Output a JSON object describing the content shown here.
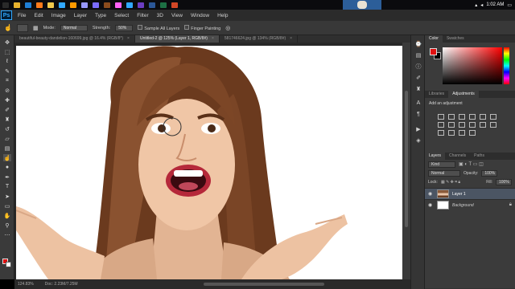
{
  "taskbar": {
    "apps": [
      {
        "name": "start",
        "color": "#2a2a2a"
      },
      {
        "name": "chrome",
        "color": "#e8b22e"
      },
      {
        "name": "edge",
        "color": "#1f7fd6"
      },
      {
        "name": "firefox",
        "color": "#ff7a1a"
      },
      {
        "name": "explorer",
        "color": "#f2c94c"
      },
      {
        "name": "photoshop",
        "color": "#31a8ff"
      },
      {
        "name": "illustrator",
        "color": "#ff9a00"
      },
      {
        "name": "premiere",
        "color": "#9999ff"
      },
      {
        "name": "after-effects",
        "color": "#7b6cff"
      },
      {
        "name": "bridge",
        "color": "#8a4b1d"
      },
      {
        "name": "adobe-xd",
        "color": "#ff61f6"
      },
      {
        "name": "lightroom",
        "color": "#31a8ff"
      },
      {
        "name": "media-encoder",
        "color": "#6b3ec2"
      },
      {
        "name": "word",
        "color": "#2b5797"
      },
      {
        "name": "excel",
        "color": "#1d7044"
      },
      {
        "name": "powerpoint",
        "color": "#d24726"
      }
    ],
    "clock": "1:02 AM"
  },
  "app": {
    "logo": "Ps"
  },
  "menu": [
    "File",
    "Edit",
    "Image",
    "Layer",
    "Type",
    "Select",
    "Filter",
    "3D",
    "View",
    "Window",
    "Help"
  ],
  "options": {
    "mode_label": "Mode:",
    "mode_value": "Normal",
    "strength_label": "Strength:",
    "strength_value": "50%",
    "sample_all": "Sample All Layers",
    "finger_painting": "Finger Painting"
  },
  "tabs": [
    {
      "label": "beautiful-beauty-dandelion-160699.jpg @ 16.4% (RGB/8*)",
      "active": false
    },
    {
      "label": "Untitled-2 @ 125% (Layer 1, RGB/8#)",
      "active": true
    },
    {
      "label": "581746624.jpg @ 134% (RGB/8#)",
      "active": false
    }
  ],
  "status": {
    "zoom": "124.83%",
    "doc": "Doc: 2.23M/7.25M"
  },
  "panels": {
    "color_tab": "Color",
    "swatches_tab": "Swatches",
    "libraries_tab": "Libraries",
    "adjustments_tab": "Adjustments",
    "add_adjustment": "Add an adjustment",
    "layers_tab": "Layers",
    "channels_tab": "Channels",
    "paths_tab": "Paths",
    "kind_label": "Kind",
    "blend_mode": "Normal",
    "opacity_label": "Opacity:",
    "opacity_value": "100%",
    "lock_label": "Lock:",
    "fill_label": "Fill:",
    "fill_value": "100%",
    "layers": [
      {
        "name": "Layer 1",
        "selected": true
      },
      {
        "name": "Background",
        "selected": false
      }
    ]
  },
  "colors": {
    "foreground": "#e01010",
    "background": "#ffffff"
  }
}
